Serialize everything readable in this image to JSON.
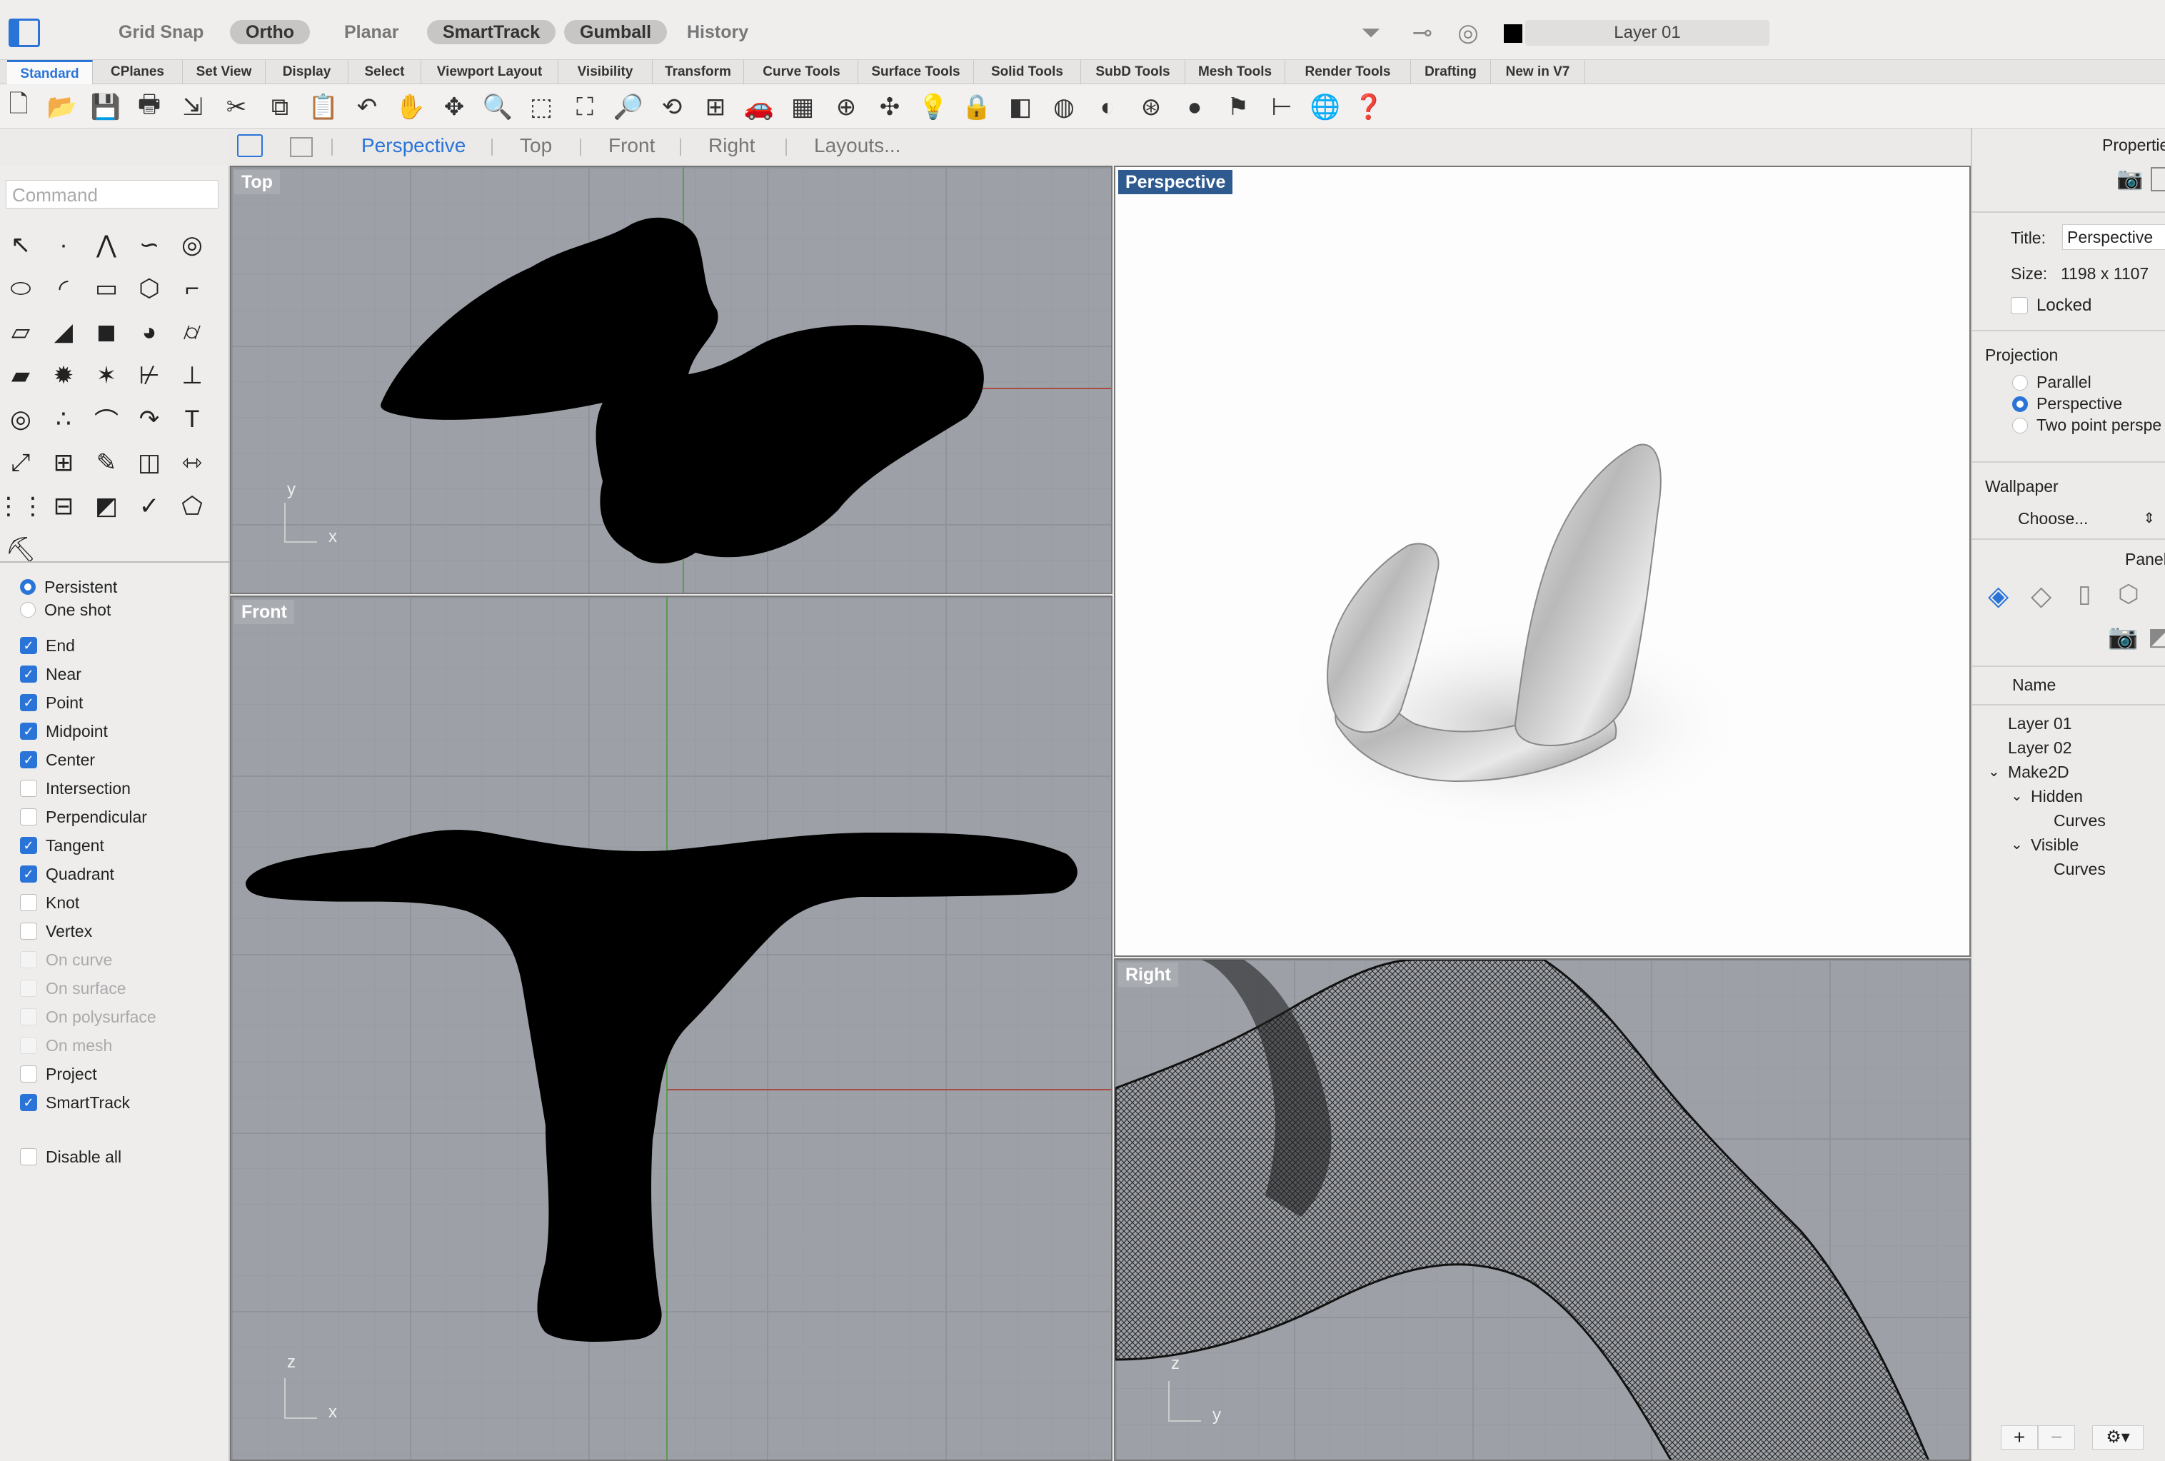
{
  "statusbar": {
    "buttons": [
      {
        "label": "Grid Snap",
        "on": false
      },
      {
        "label": "Ortho",
        "on": true
      },
      {
        "label": "Planar",
        "on": false
      },
      {
        "label": "SmartTrack",
        "on": true
      },
      {
        "label": "Gumball",
        "on": true
      },
      {
        "label": "History",
        "on": false
      }
    ],
    "layer": "Layer 01",
    "layer_color": "#000000"
  },
  "tabs": [
    "Standard",
    "CPlanes",
    "Set View",
    "Display",
    "Select",
    "Viewport Layout",
    "Visibility",
    "Transform",
    "Curve Tools",
    "Surface Tools",
    "Solid Tools",
    "SubD Tools",
    "Mesh Tools",
    "Render Tools",
    "Drafting",
    "New in V7"
  ],
  "active_tab": "Standard",
  "toolbar_icons": [
    "new-file-icon",
    "open-folder-icon",
    "save-icon",
    "print-icon",
    "import-icon",
    "cut-icon",
    "copy-icon",
    "paste-icon",
    "undo-icon",
    "pan-hand-icon",
    "rotate-view-icon",
    "zoom-icon",
    "zoom-window-icon",
    "zoom-extents-icon",
    "zoom-selected-icon",
    "zoom-dynamic-icon",
    "four-viewports-icon",
    "car-render-icon",
    "grid-plane-icon",
    "cplane-icon",
    "gumball-icon",
    "light-bulb-icon",
    "lock-icon",
    "layer-icon",
    "color-wheel-icon",
    "shaded-sphere-icon",
    "wireframe-sphere-icon",
    "render-sphere-icon",
    "properties-icon",
    "dimension-icon",
    "world-icon",
    "help-icon"
  ],
  "viewport_tabs": [
    "Perspective",
    "Top",
    "Front",
    "Right",
    "Layouts..."
  ],
  "active_viewport_tab": "Perspective",
  "command_placeholder": "Command",
  "osnap": {
    "modes": [
      "Persistent",
      "One shot"
    ],
    "selected_mode": "Persistent",
    "items": [
      {
        "label": "End",
        "checked": true,
        "disabled": false
      },
      {
        "label": "Near",
        "checked": true,
        "disabled": false
      },
      {
        "label": "Point",
        "checked": true,
        "disabled": false
      },
      {
        "label": "Midpoint",
        "checked": true,
        "disabled": false
      },
      {
        "label": "Center",
        "checked": true,
        "disabled": false
      },
      {
        "label": "Intersection",
        "checked": false,
        "disabled": false
      },
      {
        "label": "Perpendicular",
        "checked": false,
        "disabled": false
      },
      {
        "label": "Tangent",
        "checked": true,
        "disabled": false
      },
      {
        "label": "Quadrant",
        "checked": true,
        "disabled": false
      },
      {
        "label": "Knot",
        "checked": false,
        "disabled": false
      },
      {
        "label": "Vertex",
        "checked": false,
        "disabled": false
      },
      {
        "label": "On curve",
        "checked": false,
        "disabled": true
      },
      {
        "label": "On surface",
        "checked": false,
        "disabled": true
      },
      {
        "label": "On polysurface",
        "checked": false,
        "disabled": true
      },
      {
        "label": "On mesh",
        "checked": false,
        "disabled": true
      },
      {
        "label": "Project",
        "checked": false,
        "disabled": false
      },
      {
        "label": "SmartTrack",
        "checked": true,
        "disabled": false
      }
    ],
    "disable_all": {
      "label": "Disable all",
      "checked": false
    }
  },
  "viewports": {
    "top": {
      "label": "Top",
      "axis_a": "y",
      "axis_b": "x"
    },
    "front": {
      "label": "Front",
      "axis_a": "z",
      "axis_b": "x"
    },
    "right": {
      "label": "Right",
      "axis_a": "z",
      "axis_b": "y"
    },
    "perspective": {
      "label": "Perspective"
    }
  },
  "properties": {
    "header": "Properties",
    "title_label": "Title:",
    "title_value": "Perspective",
    "size_label": "Size:",
    "size_value": "1198 x 1107",
    "locked_label": "Locked",
    "projection_label": "Projection",
    "projection_options": [
      "Parallel",
      "Perspective",
      "Two point perspe"
    ],
    "projection_selected": "Perspective",
    "wallpaper_label": "Wallpaper",
    "wallpaper_choose": "Choose..."
  },
  "panels": {
    "header": "Panels",
    "column_name": "Name",
    "layers": [
      {
        "name": "Layer 01",
        "level": 0,
        "expand": ""
      },
      {
        "name": "Layer 02",
        "level": 0,
        "expand": ""
      },
      {
        "name": "Make2D",
        "level": 0,
        "expand": "v"
      },
      {
        "name": "Hidden",
        "level": 1,
        "expand": "v"
      },
      {
        "name": "Curves",
        "level": 2,
        "expand": ""
      },
      {
        "name": "Visible",
        "level": 1,
        "expand": "v"
      },
      {
        "name": "Curves",
        "level": 2,
        "expand": ""
      }
    ]
  },
  "colors": {
    "accent": "#2a74d8",
    "viewport_bg": "#9da1a7",
    "active_label": "#2e5a8f"
  }
}
